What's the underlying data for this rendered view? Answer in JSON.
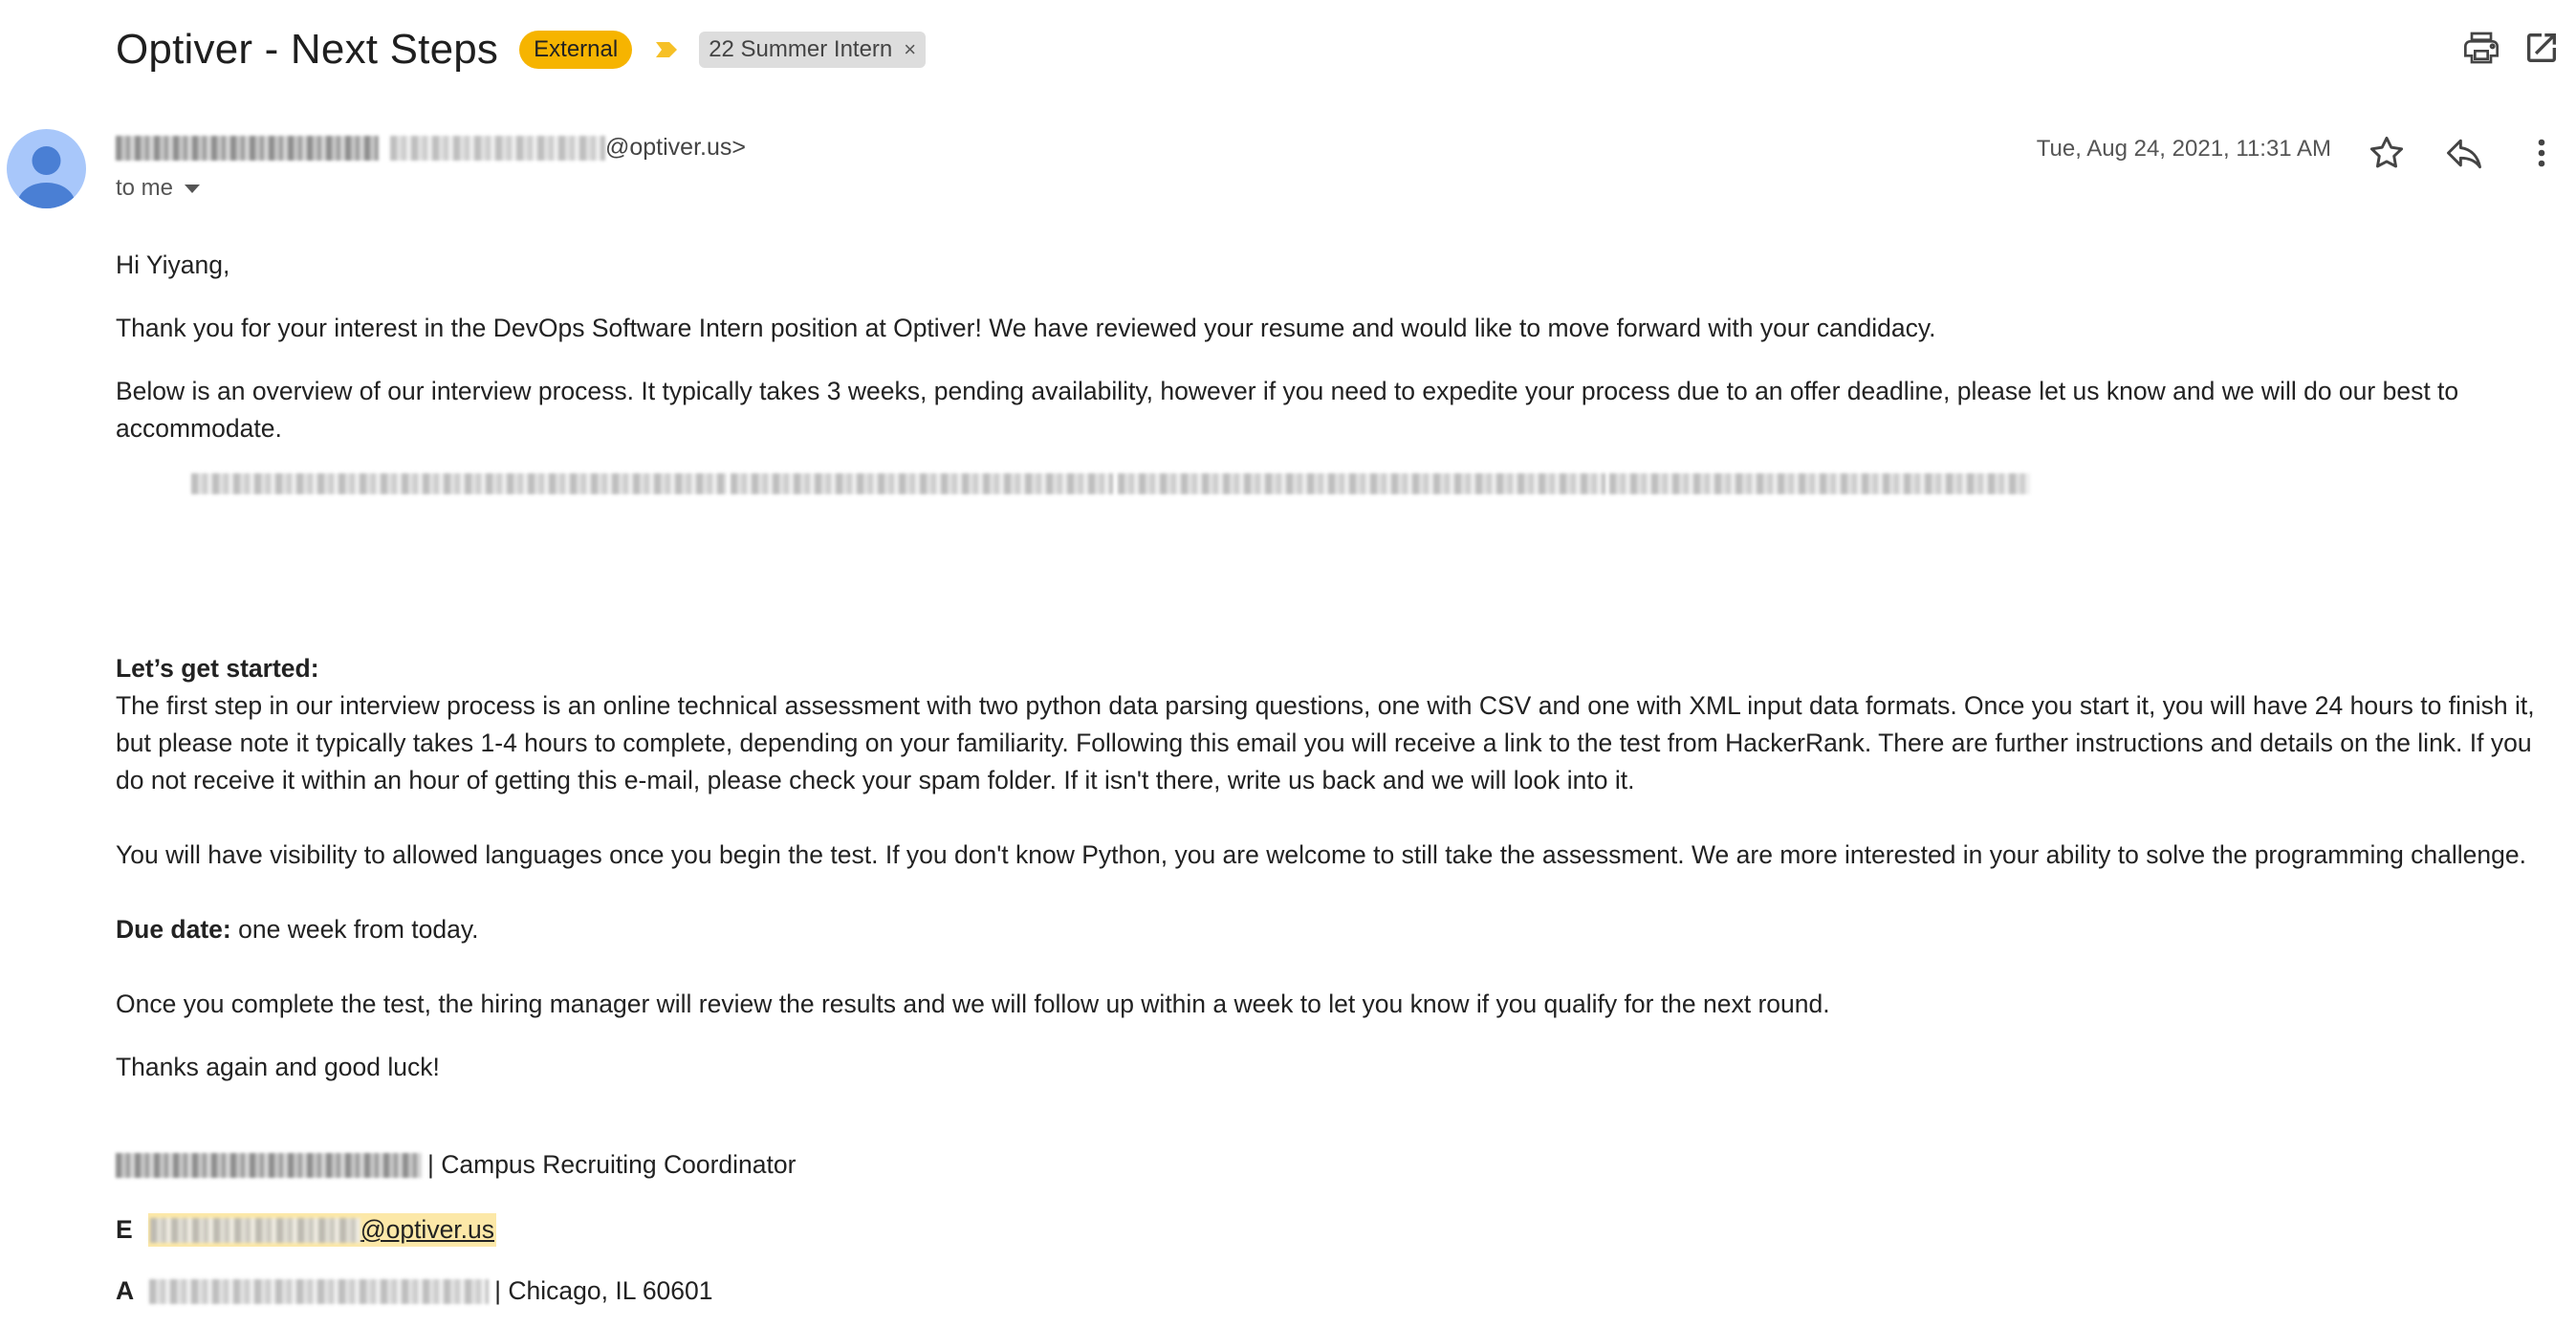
{
  "header": {
    "subject": "Optiver - Next Steps",
    "external_badge": "External",
    "label_chip": "22 Summer Intern",
    "label_remove": "×",
    "badge_color": "#f6b400"
  },
  "sender": {
    "domain": "@optiver.us>",
    "to": "to me",
    "date": "Tue, Aug 24, 2021, 11:31 AM"
  },
  "body": {
    "greeting": "Hi Yiyang,",
    "para1": "Thank you for your interest in the DevOps Software Intern position at Optiver! We have reviewed your resume and would like to move forward with your candidacy.",
    "para2": "Below is an overview of our interview process. It typically takes 3 weeks, pending availability, however if you need to expedite your process due to an offer deadline, please let us know and we will do our best to accommodate.",
    "start_heading": "Let’s get started:",
    "para3": "The first step in our interview process is an online technical assessment with two python data parsing questions, one with CSV and one with XML input data formats. Once you start it, you will have 24 hours to finish it, but please note it typically takes 1-4 hours to complete, depending on your familiarity. Following this email you will receive a link to the test from HackerRank. There are further instructions and details on the link. If you do not receive it within an hour of getting this e-mail, please check your spam folder. If it isn't there, write us back and we will look into it.",
    "para4": "You will have visibility to allowed languages once you begin the test. If you don't know Python, you are welcome to still take the assessment. We are more interested in your ability to solve the programming challenge.",
    "due_label": "Due date:",
    "due_value": " one week from today.",
    "para5": "Once you complete the test, the hiring manager will review the results and we will follow up within a week to let you know if you qualify for the next round.",
    "closing": "Thanks again and good luck!"
  },
  "signature": {
    "title": "| Campus Recruiting Coordinator",
    "email_label": "E",
    "email_domain": "@optiver.us",
    "address_label": "A",
    "address_tail": "| Chicago, IL 60601"
  },
  "icons": {
    "print": "print-icon",
    "open_new": "open-in-new-window-icon",
    "star": "star-icon",
    "reply": "reply-icon",
    "more": "more-vert-icon",
    "avatar": "default-avatar-icon",
    "importance": "importance-marker-icon"
  }
}
